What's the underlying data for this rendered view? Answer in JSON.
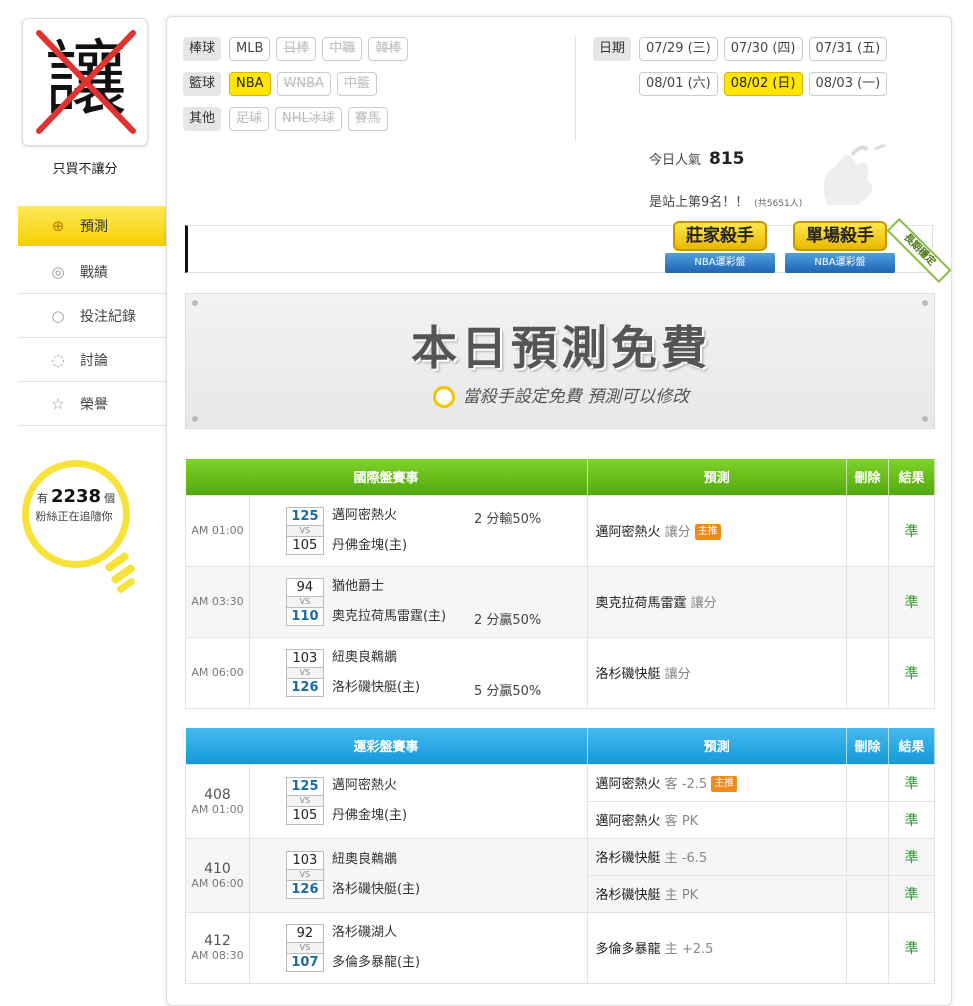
{
  "user": {
    "avatar_glyph": "讓",
    "name": "只買不讓分"
  },
  "nav": [
    {
      "label": "預測",
      "icon": "crosshair-icon",
      "active": true
    },
    {
      "label": "戰績",
      "icon": "chart-icon"
    },
    {
      "label": "投注紀錄",
      "icon": "record-icon"
    },
    {
      "label": "討論",
      "icon": "chat-icon"
    },
    {
      "label": "榮譽",
      "icon": "medal-icon"
    }
  ],
  "fans": {
    "prefix": "有",
    "count": "2238",
    "suffix": "個",
    "line2": "粉絲正在追隨你"
  },
  "filters": {
    "baseball": {
      "label": "棒球",
      "items": [
        "MLB",
        "日棒",
        "中職",
        "韓棒"
      ]
    },
    "basketball": {
      "label": "籃球",
      "items": [
        "NBA",
        "WNBA",
        "中籃"
      ]
    },
    "other": {
      "label": "其他",
      "items": [
        "足球",
        "NHL冰球",
        "賽馬"
      ]
    }
  },
  "dates": {
    "label": "日期",
    "row1": [
      "07/29 (三)",
      "07/30 (四)",
      "07/31 (五)"
    ],
    "row2": [
      "08/01 (六)",
      "08/02 (日)",
      "08/03 (一)"
    ]
  },
  "stats": {
    "pop_label": "今日人氣",
    "pop_value": "815",
    "rank_text": "是站上第9名！！",
    "rank_total": "(共5651人)"
  },
  "badges": {
    "b1_top": "莊家殺手",
    "b1_bot": "NBA運彩盤",
    "b2_top": "單場殺手",
    "b2_bot": "NBA運彩盤",
    "stamp": "長期穩定"
  },
  "banner": {
    "title": "本日預測免費",
    "subtitle": "當殺手設定免費 預測可以修改"
  },
  "intl": {
    "headers": {
      "event": "國際盤賽事",
      "predict": "預測",
      "delete": "刪除",
      "result": "結果"
    },
    "rows": [
      {
        "time": "AM 01:00",
        "s1": "125",
        "s2": "105",
        "t1": "邁阿密熱火",
        "t2": "丹佛金塊(主)",
        "handicap": "2 分輸50%",
        "hrow": 1,
        "pred": "邁阿密熱火",
        "ptype": "讓分",
        "tag": "主推",
        "result": "準"
      },
      {
        "time": "AM 03:30",
        "s1": "94",
        "s2": "110",
        "t1": "猶他爵士",
        "t2": "奧克拉荷馬雷霆(主)",
        "handicap": "2 分贏50%",
        "hrow": 2,
        "pred": "奧克拉荷馬雷霆",
        "ptype": "讓分",
        "tag": "",
        "result": "準"
      },
      {
        "time": "AM 06:00",
        "s1": "103",
        "s2": "126",
        "t1": "紐奧良鵜鶘",
        "t2": "洛杉磯快艇(主)",
        "handicap": "5 分贏50%",
        "hrow": 2,
        "pred": "洛杉磯快艇",
        "ptype": "讓分",
        "tag": "",
        "result": "準"
      }
    ]
  },
  "lottery": {
    "headers": {
      "event": "運彩盤賽事",
      "predict": "預測",
      "delete": "刪除",
      "result": "結果"
    },
    "rows": [
      {
        "num": "408",
        "time": "AM 01:00",
        "s1": "125",
        "s2": "105",
        "t1": "邁阿密熱火",
        "t2": "丹佛金塊(主)",
        "preds": [
          {
            "team": "邁阿密熱火",
            "side": "客",
            "line": "-2.5",
            "tag": "主推",
            "result": "準"
          },
          {
            "team": "邁阿密熱火",
            "side": "客",
            "line": "PK",
            "tag": "",
            "result": "準"
          }
        ]
      },
      {
        "num": "410",
        "time": "AM 06:00",
        "s1": "103",
        "s2": "126",
        "t1": "紐奧良鵜鶘",
        "t2": "洛杉磯快艇(主)",
        "preds": [
          {
            "team": "洛杉磯快艇",
            "side": "主",
            "line": "-6.5",
            "tag": "",
            "result": "準"
          },
          {
            "team": "洛杉磯快艇",
            "side": "主",
            "line": "PK",
            "tag": "",
            "result": "準"
          }
        ]
      },
      {
        "num": "412",
        "time": "AM 08:30",
        "s1": "92",
        "s2": "107",
        "t1": "洛杉磯湖人",
        "t2": "多倫多暴龍(主)",
        "preds": [
          {
            "team": "多倫多暴龍",
            "side": "主",
            "line": "+2.5",
            "tag": "",
            "result": "準"
          }
        ]
      }
    ]
  }
}
